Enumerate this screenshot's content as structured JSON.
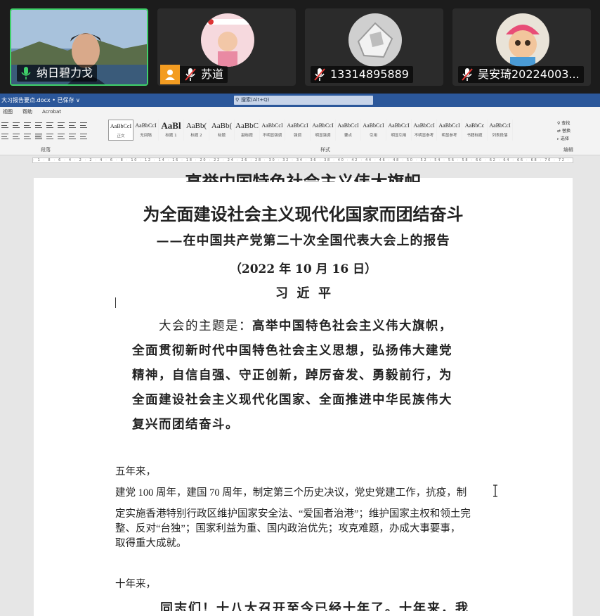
{
  "participants": [
    {
      "name": "纳日碧力戈",
      "mic": "on"
    },
    {
      "name": "苏道",
      "mic": "off"
    },
    {
      "name": "13314895889",
      "mic": "off"
    },
    {
      "name": "吴安琦20224003...",
      "mic": "off"
    }
  ],
  "word": {
    "title": "大习报告要点.docx • 已保存 ∨",
    "search_placeholder": "搜索(Alt+Q)",
    "menu": [
      "视图",
      "帮助",
      "Acrobat"
    ],
    "group_paragraph": "段落",
    "group_styles": "样式",
    "group_edit": "编辑",
    "edit_items": [
      "查找",
      "替换",
      "选择"
    ],
    "styles": [
      {
        "sample": "AaBbCcI",
        "name": "正文"
      },
      {
        "sample": "AaBbCcI",
        "name": "无间隔"
      },
      {
        "sample": "AaBl",
        "name": "标题 1"
      },
      {
        "sample": "AaBb(",
        "name": "标题 2"
      },
      {
        "sample": "AaBb(",
        "name": "标题"
      },
      {
        "sample": "AaBbC",
        "name": "副标题"
      },
      {
        "sample": "AaBbCcI",
        "name": "不明显强调"
      },
      {
        "sample": "AaBbCcI",
        "name": "强调"
      },
      {
        "sample": "AaBbCcI",
        "name": "明显强调"
      },
      {
        "sample": "AaBbCcI",
        "name": "要点"
      },
      {
        "sample": "AaBbCcI",
        "name": "引用"
      },
      {
        "sample": "AaBbCcI",
        "name": "明显引用"
      },
      {
        "sample": "AaBbCcI",
        "name": "不明显参考"
      },
      {
        "sample": "AaBbCcI",
        "name": "明显参考"
      },
      {
        "sample": "AaBbCc",
        "name": "书籍标题"
      },
      {
        "sample": "AaBbCcI",
        "name": "列表段落"
      }
    ],
    "doc": {
      "heading_partial": "高举中国特色社会主义伟大旗帜",
      "heading": "为全面建设社会主义现代化国家而团结奋斗",
      "subheading": "——在中国共产党第二十次全国代表大会上的报告",
      "date": "（2022 年 10 月 16 日）",
      "author": "习  近  平",
      "theme_lead": "大会的主题是：",
      "theme_lines": [
        "高举中国特色社会主义伟大旗帜，",
        "全面贯彻新时代中国特色社会主义思想，弘扬伟大建党",
        "精神，自信自强、守正创新，踔厉奋发、勇毅前行，为",
        "全面建设社会主义现代化国家、全面推进中华民族伟大",
        "复兴而团结奋斗。"
      ],
      "five_years": "五年来，",
      "para1_lines": [
        "建党 100 周年，建国 70 周年，制定第三个历史决议，党史党建工作，抗疫，制",
        "定实施香港特别行政区维护国家安全法、“爱国者治港”；维护国家主权和领土完",
        "整、反对“台独”；国家利益为重、国内政治优先；攻克难题，办成大事要事，",
        "取得重大成就。"
      ],
      "ten_years": "十年来，",
      "partial_last": "同志们！十八大召开至今已经十年了。十年来，我"
    }
  }
}
